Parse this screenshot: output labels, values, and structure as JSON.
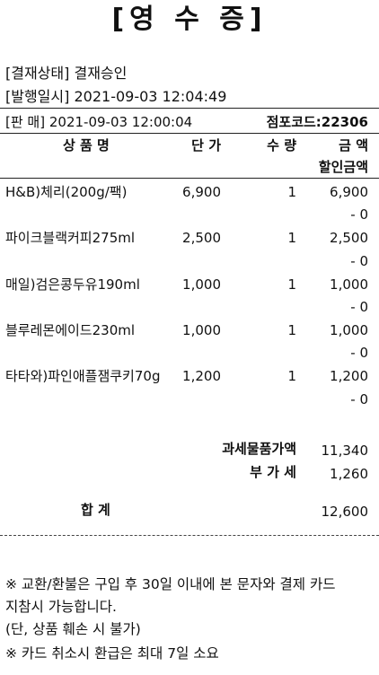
{
  "receipt": {
    "title": "[영 수 증]",
    "status_label": "[결재상태]",
    "status_value": "결재승인",
    "issue_label": "[발행일시]",
    "issue_value": "2021-09-03 12:04:49",
    "sale_label": "[판 매]",
    "sale_value": "2021-09-03 12:00:04",
    "store_code": "점포코드:22306"
  },
  "table": {
    "headers": {
      "name": "상 품 명",
      "price": "단 가",
      "qty": "수 량",
      "amount": "금 액",
      "discount": "할인금액"
    },
    "items": [
      {
        "name": "H&B)체리(200g/팩)",
        "price": "6,900",
        "qty": "1",
        "amount": "6,900",
        "discount": "- 0"
      },
      {
        "name": "파이크블랙커피275ml",
        "price": "2,500",
        "qty": "1",
        "amount": "2,500",
        "discount": "- 0"
      },
      {
        "name": "매일)검은콩두유190ml",
        "price": "1,000",
        "qty": "1",
        "amount": "1,000",
        "discount": "- 0"
      },
      {
        "name": "블루레몬에이드230ml",
        "price": "1,000",
        "qty": "1",
        "amount": "1,000",
        "discount": "- 0"
      },
      {
        "name": "타타와)파인애플잼쿠키70g",
        "price": "1,200",
        "qty": "1",
        "amount": "1,200",
        "discount": "- 0"
      }
    ]
  },
  "totals": {
    "taxable_label": "과세물품가액",
    "taxable_value": "11,340",
    "vat_label": "부 가 세",
    "vat_value": "1,260",
    "total_label": "합 계",
    "total_value": "12,600"
  },
  "notice": {
    "line1": "※ 교환/환불은 구입 후 30일 이내에 본 문자와 결제 카드",
    "line2": "지참시 가능합니다.",
    "line3": "(단, 상품 훼손 시 불가)",
    "line4": "※ 카드 취소시 환급은 최대 7일 소요"
  }
}
